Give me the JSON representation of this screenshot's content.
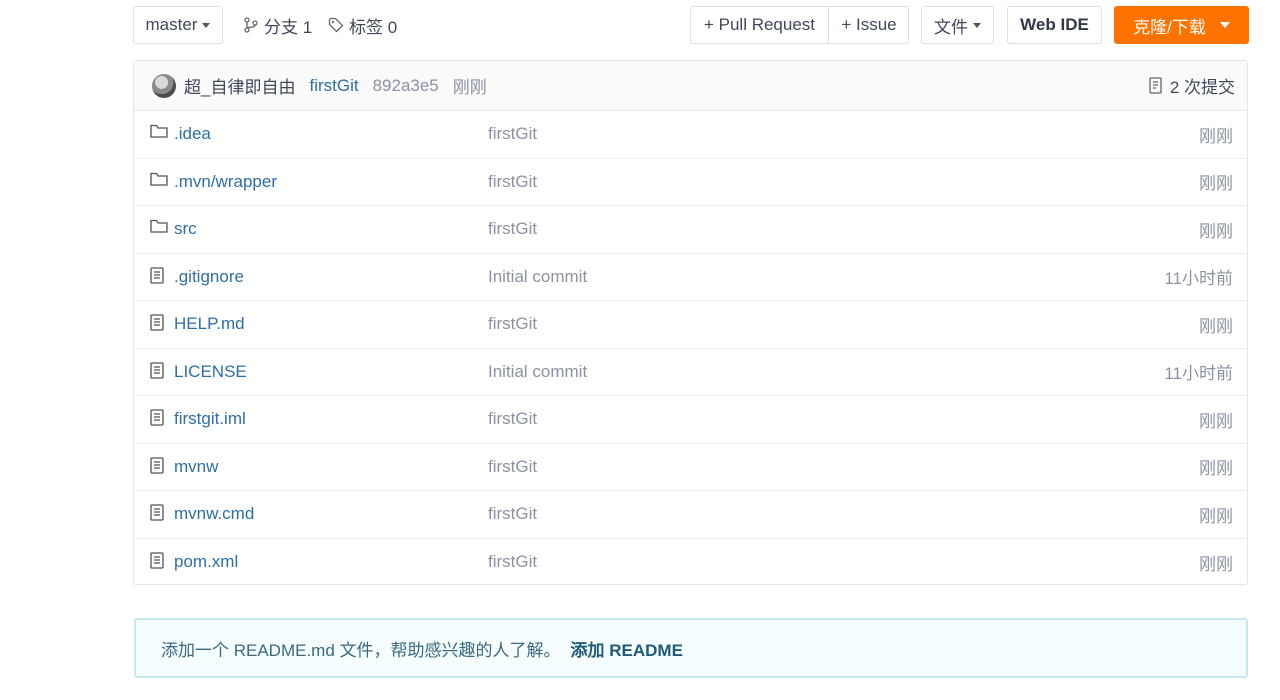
{
  "toolbar": {
    "branch": "master",
    "branches_label": "分支 1",
    "tags_label": "标签 0",
    "pull_request_label": "+ Pull Request",
    "issue_label": "+ Issue",
    "file_label": "文件",
    "web_ide_label": "Web IDE",
    "clone_label": "克隆/下载",
    "clone_color": "#fe7300"
  },
  "commit": {
    "author": "超_自律即自由",
    "message": "firstGit",
    "sha": "892a3e5",
    "time": "刚刚",
    "count_label": "2 次提交"
  },
  "files": [
    {
      "type": "folder",
      "name": ".idea",
      "message": "firstGit",
      "time": "刚刚"
    },
    {
      "type": "folder",
      "name": ".mvn/wrapper",
      "message": "firstGit",
      "time": "刚刚"
    },
    {
      "type": "folder",
      "name": "src",
      "message": "firstGit",
      "time": "刚刚"
    },
    {
      "type": "file",
      "name": ".gitignore",
      "message": "Initial commit",
      "time": "11小时前"
    },
    {
      "type": "file",
      "name": "HELP.md",
      "message": "firstGit",
      "time": "刚刚"
    },
    {
      "type": "file",
      "name": "LICENSE",
      "message": "Initial commit",
      "time": "11小时前"
    },
    {
      "type": "file",
      "name": "firstgit.iml",
      "message": "firstGit",
      "time": "刚刚"
    },
    {
      "type": "file",
      "name": "mvnw",
      "message": "firstGit",
      "time": "刚刚"
    },
    {
      "type": "file",
      "name": "mvnw.cmd",
      "message": "firstGit",
      "time": "刚刚"
    },
    {
      "type": "file",
      "name": "pom.xml",
      "message": "firstGit",
      "time": "刚刚"
    }
  ],
  "readme_tip": {
    "text": "添加一个 README.md 文件，帮助感兴趣的人了解。",
    "link": "添加 README"
  }
}
